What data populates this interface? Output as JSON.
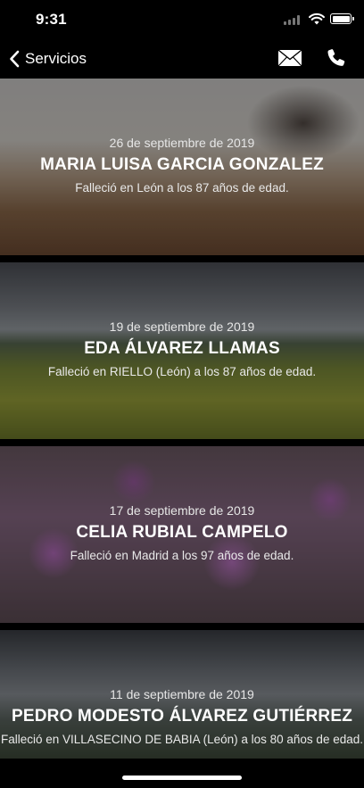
{
  "status_bar": {
    "time": "9:31"
  },
  "nav": {
    "back_label": "Servicios",
    "icons": [
      "chevron-left-icon",
      "mail-icon",
      "phone-icon"
    ]
  },
  "obituaries": [
    {
      "date": "26 de septiembre de 2019",
      "name": "MARIA LUISA GARCIA GONZALEZ",
      "info": "Falleció en León a los 87 años de edad."
    },
    {
      "date": "19 de septiembre de 2019",
      "name": "EDA ÁLVAREZ LLAMAS",
      "info": "Falleció en RIELLO (León) a los 87 años de edad."
    },
    {
      "date": "17 de septiembre de 2019",
      "name": "CELIA RUBIAL CAMPELO",
      "info": "Falleció en Madrid a los 97 años de edad."
    },
    {
      "date": "11 de septiembre de 2019",
      "name": "PEDRO MODESTO ÁLVAREZ GUTIÉRREZ",
      "info": "Falleció en VILLASECINO DE BABIA (León) a los 80 años de edad."
    }
  ],
  "colors": {
    "background": "#000000",
    "text": "#ffffff"
  }
}
